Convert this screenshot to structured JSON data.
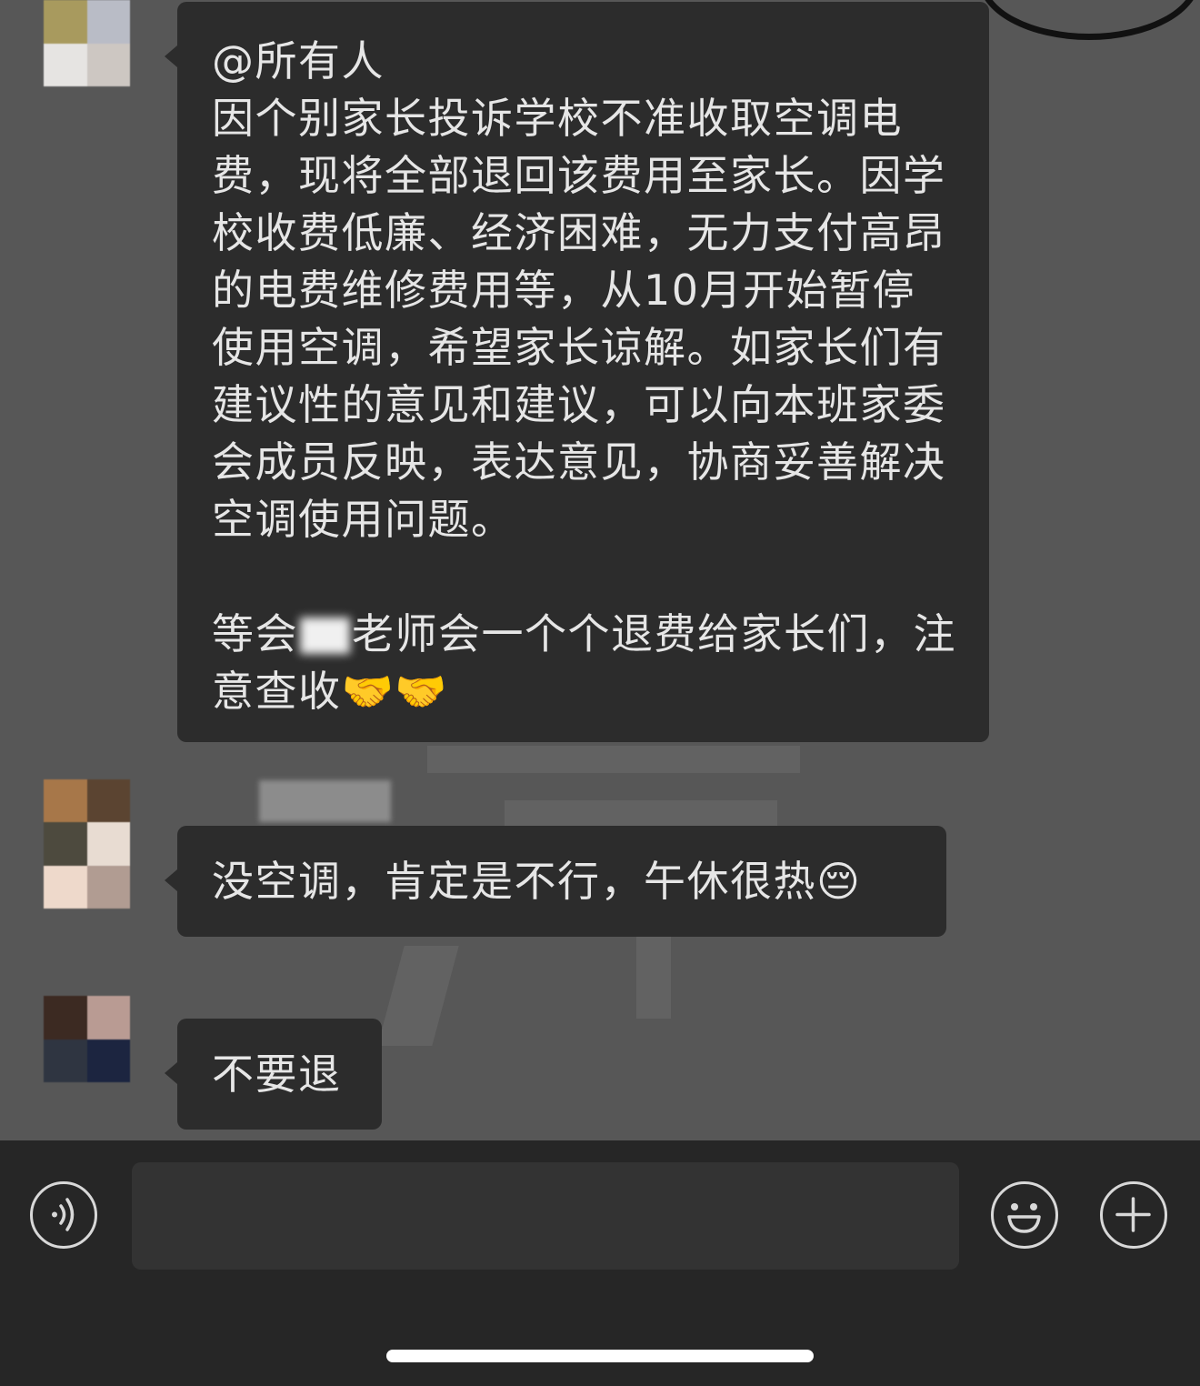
{
  "messages": [
    {
      "text": "@所有人\n因个别家长投诉学校不准收取空调电费，现将全部退回该费用至家长。因学校收费低廉、经济困难，无力支付高昂的电费维修费用等，从10月开始暂停使用空调，希望家长谅解。如家长们有建议性的意见和建议，可以向本班家委会成员反映，表达意见，协商妥善解决空调使用问题。\n\n等会",
      "text_tail": "老师会一个个退费给家长们，注意查收🤝🤝"
    },
    {
      "text": "没空调，肯定是不行，午休很热😔"
    },
    {
      "text": "不要退"
    }
  ],
  "composer": {
    "voice_icon": "voice-icon",
    "emoji_icon": "emoji-icon",
    "plus_icon": "plus-icon"
  }
}
